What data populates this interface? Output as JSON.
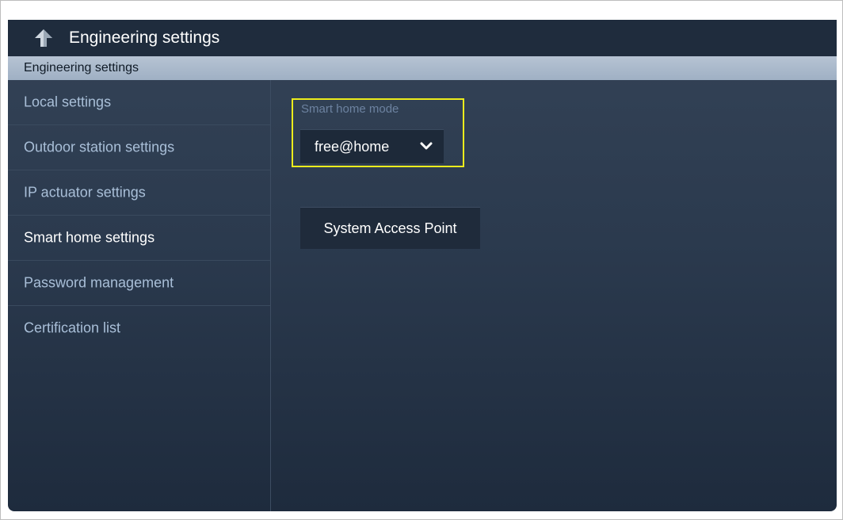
{
  "titlebar": {
    "title": "Engineering settings",
    "back_icon": "back-arrow-icon"
  },
  "section_header": {
    "label": "Engineering settings"
  },
  "sidebar": {
    "items": [
      {
        "label": "Local settings"
      },
      {
        "label": "Outdoor station settings"
      },
      {
        "label": "IP actuator settings"
      },
      {
        "label": "Smart home settings"
      },
      {
        "label": "Password management"
      },
      {
        "label": "Certification list"
      }
    ],
    "active_index": 3
  },
  "content": {
    "smart_home_mode": {
      "label": "Smart home mode",
      "value": "free@home",
      "icon": "chevron-down-icon"
    },
    "system_access_point_button": {
      "label": "System Access Point"
    }
  },
  "colors": {
    "highlight": "#ecec1c",
    "active_text": "#ffffff",
    "inactive_text": "#a9bfd8",
    "header_band": "#b6c3d3"
  }
}
